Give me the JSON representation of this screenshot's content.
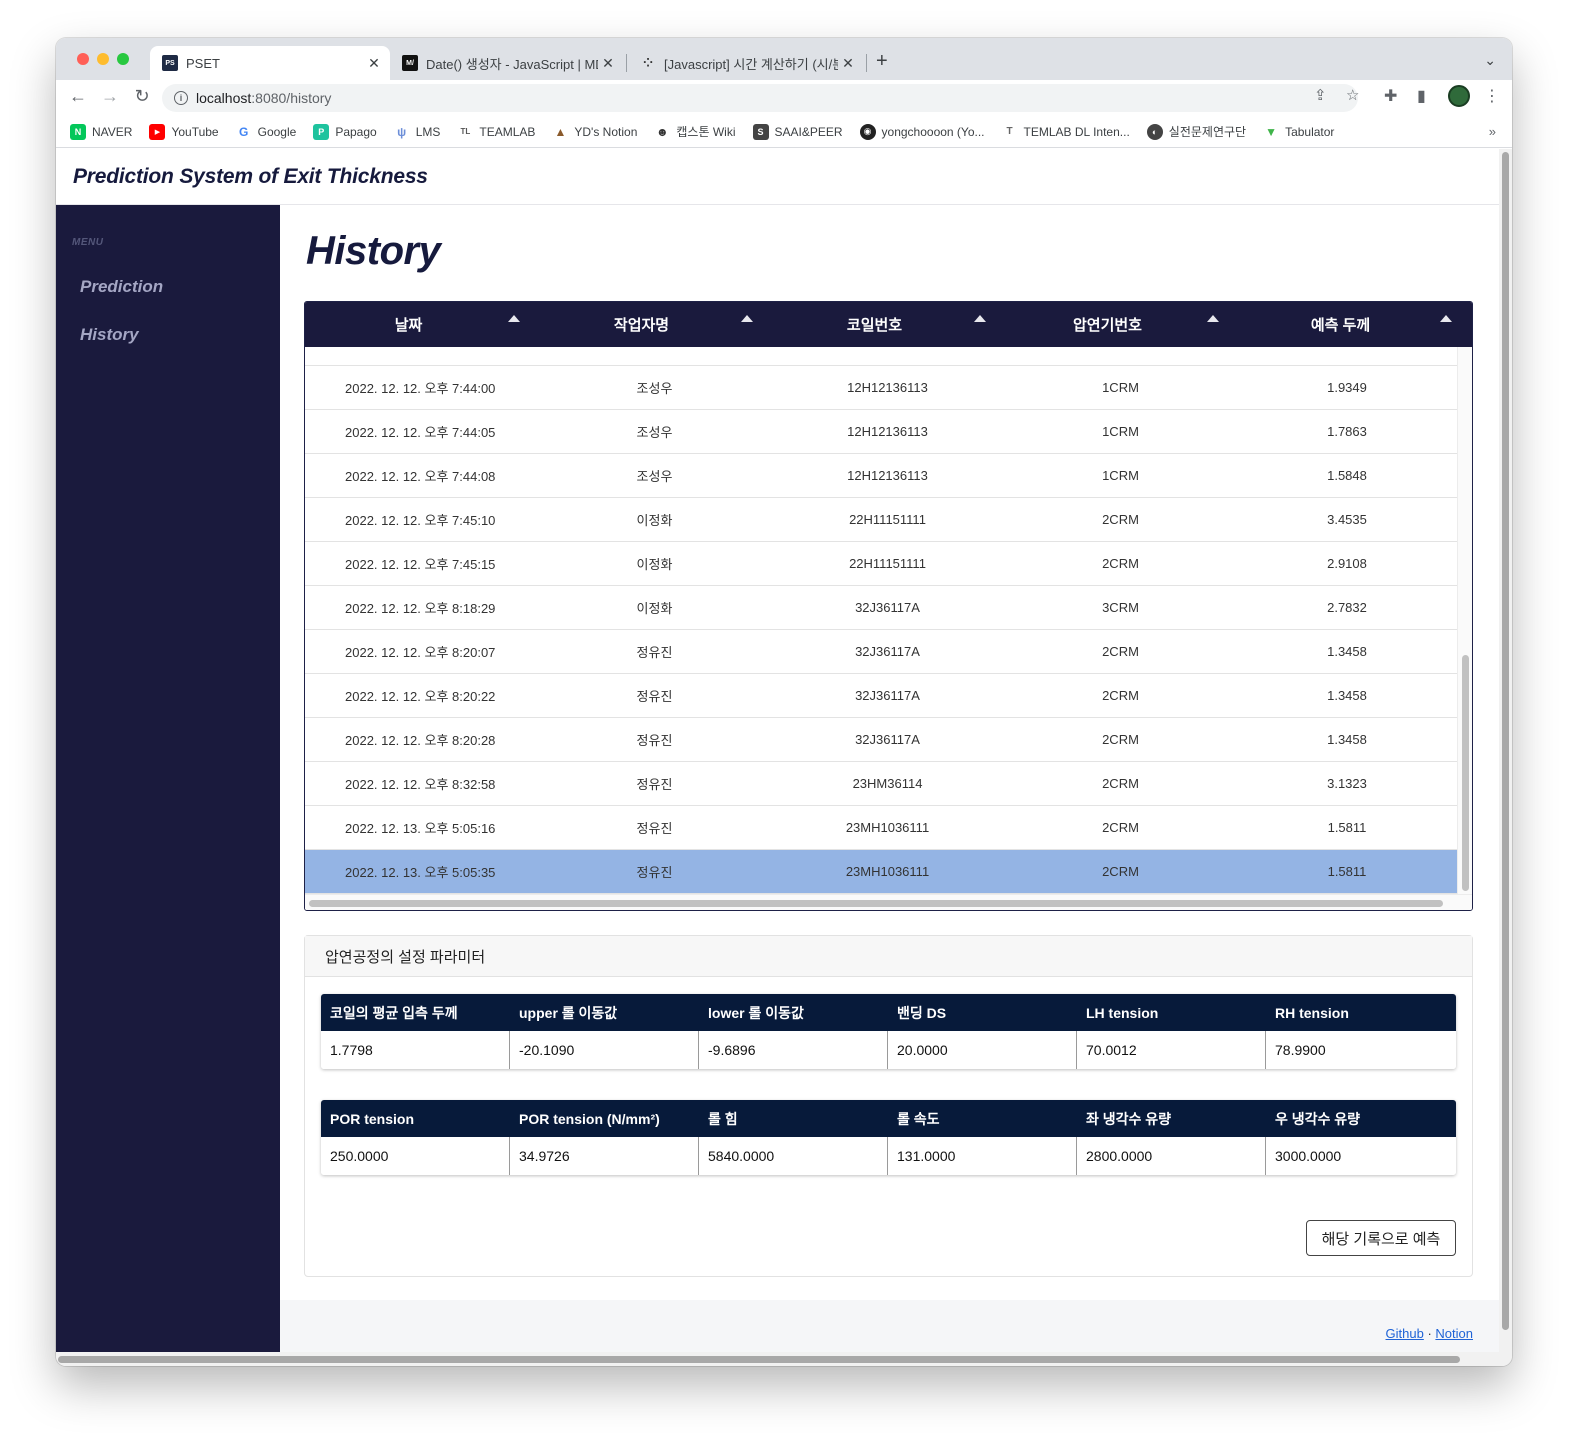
{
  "browser": {
    "tabs": [
      {
        "title": "PSET",
        "favicon": "PS\nET",
        "active": true
      },
      {
        "title": "Date() 생성자 - JavaScript | MDN",
        "favicon": "M/"
      },
      {
        "title": "[Javascript] 시간 계산하기 (시/분/",
        "favicon": "⁘"
      }
    ],
    "url_host": "localhost",
    "url_path": ":8080/history",
    "bookmarks": [
      {
        "label": "NAVER",
        "color": "#03c75a",
        "glyph": "N"
      },
      {
        "label": "YouTube",
        "color": "#ff0000",
        "glyph": "▶"
      },
      {
        "label": "Google",
        "color": "#4285f4",
        "glyph": "G"
      },
      {
        "label": "Papago",
        "color": "#1ec39e",
        "glyph": "P"
      },
      {
        "label": "LMS",
        "color": "#6c8ed8",
        "glyph": "ψ"
      },
      {
        "label": "TEAMLAB",
        "color": "#555555",
        "glyph": "T"
      },
      {
        "label": "YD's Notion",
        "color": "#8a5a2b",
        "glyph": "▲"
      },
      {
        "label": "캡스톤 Wiki",
        "color": "#333333",
        "glyph": "W"
      },
      {
        "label": "SAAI&PEER",
        "color": "#444444",
        "glyph": "S"
      },
      {
        "label": "yongchoooon (Yo...",
        "color": "#222222",
        "glyph": "◉"
      },
      {
        "label": "TEMLAB DL Inten...",
        "color": "#666666",
        "glyph": "T"
      },
      {
        "label": "실전문제연구단",
        "color": "#444444",
        "glyph": "◐"
      },
      {
        "label": "Tabulator",
        "color": "#3fb449",
        "glyph": "▼"
      }
    ]
  },
  "site": {
    "title": "Prediction System of Exit Thickness"
  },
  "sidebar": {
    "menu_label": "MENU",
    "items": [
      {
        "label": "Prediction"
      },
      {
        "label": "History"
      }
    ]
  },
  "main": {
    "heading": "History",
    "history_table": {
      "columns": [
        "날짜",
        "작업자명",
        "코일번호",
        "압연기번호",
        "예측 두께"
      ],
      "rows": [
        [
          "2022. 12. 12. 오후 7:44:00",
          "조성우",
          "12H12136113",
          "1CRM",
          "1.9349"
        ],
        [
          "2022. 12. 12. 오후 7:44:05",
          "조성우",
          "12H12136113",
          "1CRM",
          "1.7863"
        ],
        [
          "2022. 12. 12. 오후 7:44:08",
          "조성우",
          "12H12136113",
          "1CRM",
          "1.5848"
        ],
        [
          "2022. 12. 12. 오후 7:45:10",
          "이정화",
          "22H11151111",
          "2CRM",
          "3.4535"
        ],
        [
          "2022. 12. 12. 오후 7:45:15",
          "이정화",
          "22H11151111",
          "2CRM",
          "2.9108"
        ],
        [
          "2022. 12. 12. 오후 8:18:29",
          "이정화",
          "32J36117A",
          "3CRM",
          "2.7832"
        ],
        [
          "2022. 12. 12. 오후 8:20:07",
          "정유진",
          "32J36117A",
          "2CRM",
          "1.3458"
        ],
        [
          "2022. 12. 12. 오후 8:20:22",
          "정유진",
          "32J36117A",
          "2CRM",
          "1.3458"
        ],
        [
          "2022. 12. 12. 오후 8:20:28",
          "정유진",
          "32J36117A",
          "2CRM",
          "1.3458"
        ],
        [
          "2022. 12. 12. 오후 8:32:58",
          "정유진",
          "23HM36114",
          "2CRM",
          "3.1323"
        ],
        [
          "2022. 12. 13. 오후 5:05:16",
          "정유진",
          "23MH1036111",
          "2CRM",
          "1.5811"
        ],
        [
          "2022. 12. 13. 오후 5:05:35",
          "정유진",
          "23MH1036111",
          "2CRM",
          "1.5811"
        ]
      ],
      "selected_row": 11
    },
    "params_card": {
      "title": "압연공정의 설정 파라미터",
      "table1": {
        "headers": [
          "코일의 평균 입측 두께",
          "upper 롤 이동값",
          "lower 롤 이동값",
          "밴딩 DS",
          "LH tension",
          "RH tension"
        ],
        "values": [
          "1.7798",
          "-20.1090",
          "-9.6896",
          "20.0000",
          "70.0012",
          "78.9900"
        ]
      },
      "table2": {
        "headers": [
          "POR tension",
          "POR tension (N/mm²)",
          "롤 힘",
          "롤 속도",
          "좌 냉각수 유량",
          "우 냉각수 유량"
        ],
        "values": [
          "250.0000",
          "34.9726",
          "5840.0000",
          "131.0000",
          "2800.0000",
          "3000.0000"
        ]
      },
      "predict_button": "해당 기록으로 예측"
    }
  },
  "footer": {
    "github": "Github",
    "separator": "·",
    "notion": "Notion"
  }
}
